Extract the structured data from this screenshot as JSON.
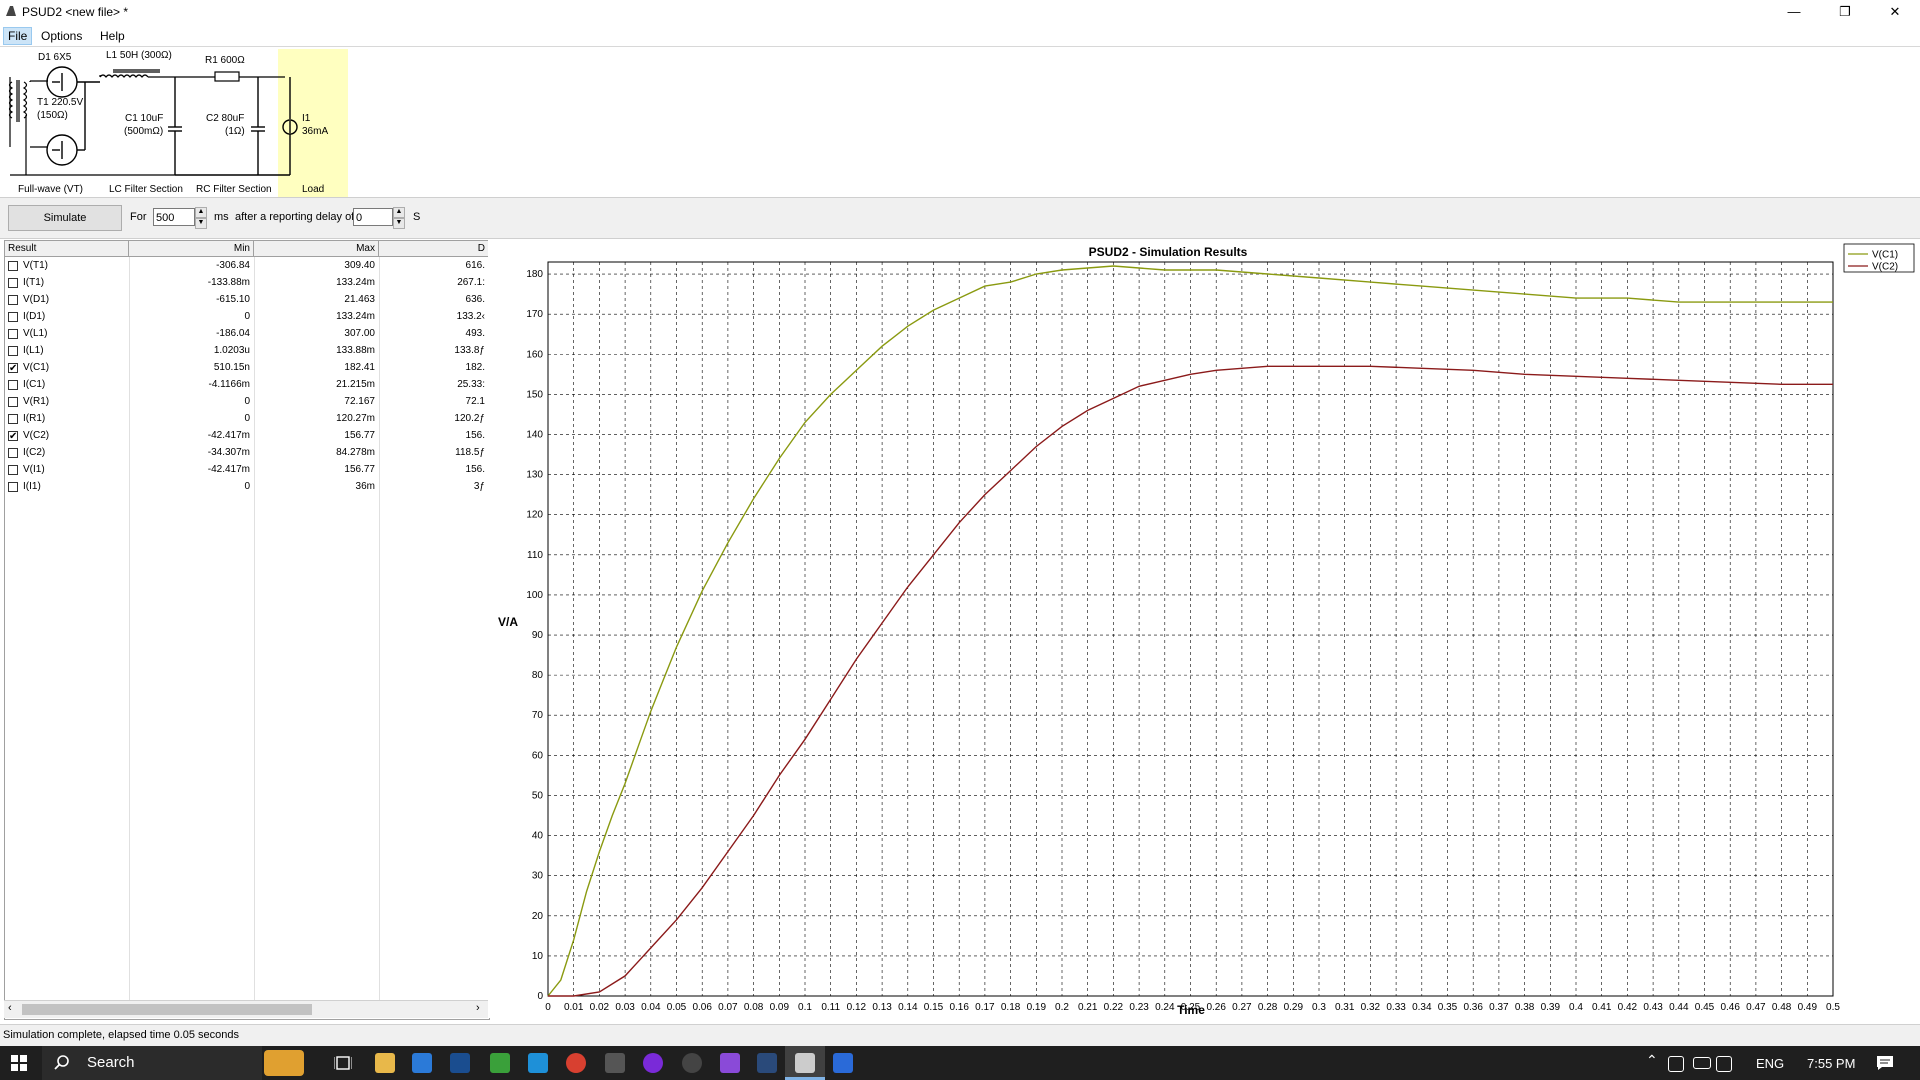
{
  "window": {
    "title": "PSUD2  <new file> *",
    "minimize": "—",
    "restore": "❐",
    "close": "✕"
  },
  "menu": [
    "File",
    "Options",
    "Help"
  ],
  "schematic": {
    "d1": "D1 6X5",
    "l1": "L1 50H (300Ω)",
    "r1": "R1 600Ω",
    "t1_line1": "T1 220.5V",
    "t1_line2": "(150Ω)",
    "c1_line1": "C1 10uF",
    "c1_line2": "(500mΩ)",
    "c2_line1": "C2 80uF",
    "c2_line2": "(1Ω)",
    "i1_line1": "I1",
    "i1_line2": "36mA",
    "sections": [
      "Full-wave (VT)",
      "LC Filter Section",
      "RC Filter Section",
      "Load"
    ],
    "load_color": "#ffffc0"
  },
  "simbar": {
    "simulate_label": "Simulate",
    "for_label": "For",
    "duration": "500",
    "ms_label": "ms",
    "delay_label": "after a reporting delay of",
    "delay": "0",
    "s_label": "S"
  },
  "table": {
    "columns": [
      "Result",
      "Min",
      "Max",
      "D"
    ],
    "rows": [
      {
        "name": "V(T1)",
        "min": "-306.84",
        "max": "309.40",
        "d": "616.",
        "checked": false
      },
      {
        "name": "I(T1)",
        "min": "-133.88m",
        "max": "133.24m",
        "d": "267.1:",
        "checked": false
      },
      {
        "name": "V(D1)",
        "min": "-615.10",
        "max": "21.463",
        "d": "636.",
        "checked": false
      },
      {
        "name": "I(D1)",
        "min": "0",
        "max": "133.24m",
        "d": "133.2‹",
        "checked": false
      },
      {
        "name": "V(L1)",
        "min": "-186.04",
        "max": "307.00",
        "d": "493.",
        "checked": false
      },
      {
        "name": "I(L1)",
        "min": "1.0203u",
        "max": "133.88m",
        "d": "133.8ƒ",
        "checked": false
      },
      {
        "name": "V(C1)",
        "min": "510.15n",
        "max": "182.41",
        "d": "182.",
        "checked": true
      },
      {
        "name": "I(C1)",
        "min": "-4.1166m",
        "max": "21.215m",
        "d": "25.33:",
        "checked": false
      },
      {
        "name": "V(R1)",
        "min": "0",
        "max": "72.167",
        "d": "72.1",
        "checked": false
      },
      {
        "name": "I(R1)",
        "min": "0",
        "max": "120.27m",
        "d": "120.2ƒ",
        "checked": false
      },
      {
        "name": "V(C2)",
        "min": "-42.417m",
        "max": "156.77",
        "d": "156.",
        "checked": true
      },
      {
        "name": "I(C2)",
        "min": "-34.307m",
        "max": "84.278m",
        "d": "118.5ƒ",
        "checked": false
      },
      {
        "name": "V(I1)",
        "min": "-42.417m",
        "max": "156.77",
        "d": "156.",
        "checked": false
      },
      {
        "name": "I(I1)",
        "min": "0",
        "max": "36m",
        "d": "3ƒ",
        "checked": false
      }
    ]
  },
  "status": "Simulation complete, elapsed time 0.05 seconds",
  "taskbar": {
    "search": "Search",
    "lang": "ENG",
    "time": "7:55 PM"
  },
  "chart_data": {
    "type": "line",
    "title": "PSUD2 - Simulation Results",
    "xlabel": "Time",
    "ylabel": "V/A",
    "xlim": [
      0,
      0.5
    ],
    "ylim": [
      0,
      183
    ],
    "xticks": [
      "0",
      "0.01",
      "0.02",
      "0.03",
      "0.04",
      "0.05",
      "0.06",
      "0.07",
      "0.08",
      "0.09",
      "0.1",
      "0.11",
      "0.12",
      "0.13",
      "0.14",
      "0.15",
      "0.16",
      "0.17",
      "0.18",
      "0.19",
      "0.2",
      "0.21",
      "0.22",
      "0.23",
      "0.24",
      "0.25",
      "0.26",
      "0.27",
      "0.28",
      "0.29",
      "0.3",
      "0.31",
      "0.32",
      "0.33",
      "0.34",
      "0.35",
      "0.36",
      "0.37",
      "0.38",
      "0.39",
      "0.4",
      "0.41",
      "0.42",
      "0.43",
      "0.44",
      "0.45",
      "0.46",
      "0.47",
      "0.48",
      "0.49",
      "0.5"
    ],
    "yticks": [
      0,
      10,
      20,
      30,
      40,
      50,
      60,
      70,
      80,
      90,
      100,
      110,
      120,
      130,
      140,
      150,
      160,
      170,
      180
    ],
    "grid": true,
    "legend": "top-right",
    "series": [
      {
        "name": "V(C1)",
        "color": "#8a9a10",
        "x": [
          0,
          0.005,
          0.01,
          0.015,
          0.02,
          0.025,
          0.03,
          0.035,
          0.04,
          0.045,
          0.05,
          0.06,
          0.07,
          0.08,
          0.09,
          0.1,
          0.11,
          0.12,
          0.13,
          0.14,
          0.15,
          0.16,
          0.17,
          0.18,
          0.19,
          0.2,
          0.22,
          0.24,
          0.26,
          0.28,
          0.3,
          0.32,
          0.34,
          0.36,
          0.38,
          0.4,
          0.42,
          0.44,
          0.46,
          0.48,
          0.5
        ],
        "y": [
          0,
          4,
          14,
          26,
          36,
          45,
          53,
          62,
          71,
          79,
          87,
          101,
          113,
          124,
          134,
          143,
          150,
          156,
          162,
          167,
          171,
          174,
          177,
          178,
          180,
          181,
          182,
          181,
          181,
          180,
          179,
          178,
          177,
          176,
          175,
          174,
          174,
          173,
          173,
          173,
          173
        ]
      },
      {
        "name": "V(C2)",
        "color": "#8b1a1a",
        "x": [
          0,
          0.01,
          0.02,
          0.03,
          0.04,
          0.05,
          0.06,
          0.07,
          0.08,
          0.09,
          0.1,
          0.11,
          0.12,
          0.13,
          0.14,
          0.15,
          0.16,
          0.17,
          0.18,
          0.19,
          0.2,
          0.21,
          0.22,
          0.23,
          0.24,
          0.25,
          0.26,
          0.27,
          0.28,
          0.29,
          0.3,
          0.32,
          0.34,
          0.36,
          0.38,
          0.4,
          0.42,
          0.44,
          0.46,
          0.48,
          0.5
        ],
        "y": [
          0,
          0,
          1,
          5,
          12,
          19,
          27,
          36,
          45,
          55,
          64,
          74,
          84,
          93,
          102,
          110,
          118,
          125,
          131,
          137,
          142,
          146,
          149,
          152,
          153.5,
          155,
          156,
          156.5,
          157,
          157,
          157,
          157,
          156.5,
          156,
          155,
          154.5,
          154,
          153.5,
          153,
          152.5,
          152.5
        ]
      }
    ]
  }
}
